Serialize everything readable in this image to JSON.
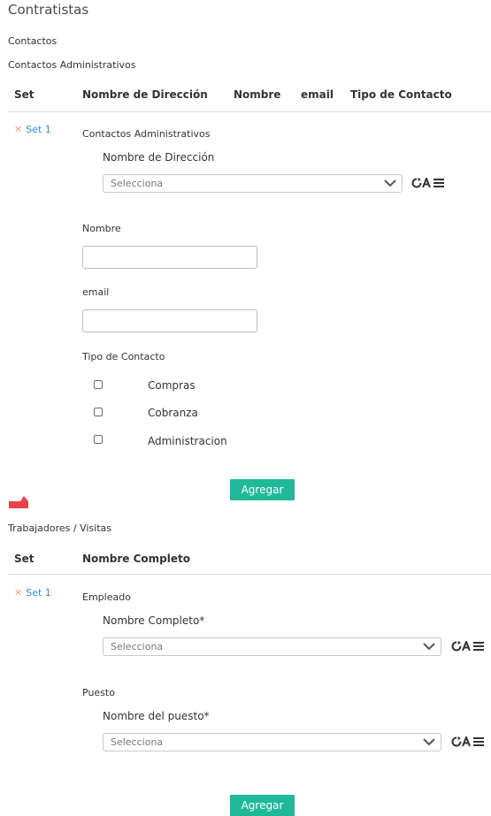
{
  "page": {
    "title": "Contratistas"
  },
  "contactos": {
    "section_label": "Contactos",
    "subsection_label": "Contactos Administrativos",
    "headers": [
      "Set",
      "Nombre de Dirección",
      "Nombre",
      "email",
      "Tipo de Contacto"
    ],
    "set_label": "Set 1",
    "group_label": "Contactos Administrativos",
    "direccion": {
      "label": "Nombre de Dirección",
      "placeholder": "Selecciona"
    },
    "nombre": {
      "label": "Nombre",
      "value": ""
    },
    "email": {
      "label": "email",
      "value": ""
    },
    "tipo": {
      "label": "Tipo de Contacto",
      "options": [
        {
          "label": "Compras",
          "checked": false
        },
        {
          "label": "Cobranza",
          "checked": false
        },
        {
          "label": "Administracion",
          "checked": false
        }
      ]
    },
    "add_label": "Agregar"
  },
  "trabajadores": {
    "section_label": "Trabajadores / Visitas",
    "headers": [
      "Set",
      "Nombre Completo"
    ],
    "set_label": "Set 1",
    "empleado_label": "Empleado",
    "nombre_completo": {
      "label": "Nombre Completo*",
      "placeholder": "Selecciona"
    },
    "puesto_label": "Puesto",
    "nombre_puesto": {
      "label": "Nombre del puesto*",
      "placeholder": "Selecciona"
    },
    "add_label": "Agregar"
  },
  "colors": {
    "accent": "#1fb99a",
    "link": "#2f8fd6",
    "marker": "#e8434f"
  }
}
